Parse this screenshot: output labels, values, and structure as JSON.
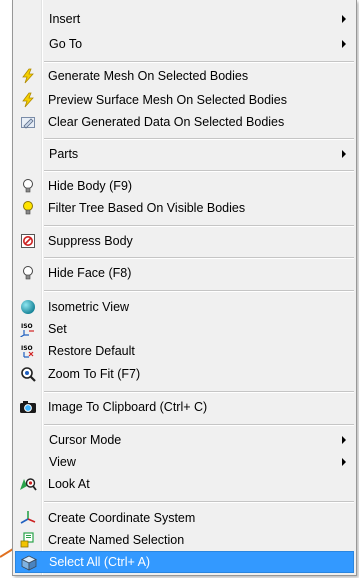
{
  "menu": {
    "items": [
      {
        "id": "insert",
        "label": "Insert",
        "submenu": true,
        "icon": ""
      },
      {
        "id": "goto",
        "label": "Go To",
        "submenu": true,
        "icon": ""
      },
      {
        "id": "generate-mesh",
        "label": "Generate Mesh On Selected Bodies",
        "icon": "lightning-bolt-icon"
      },
      {
        "id": "preview-surface-mesh",
        "label": "Preview Surface Mesh On Selected Bodies",
        "icon": "lightning-bolt-icon"
      },
      {
        "id": "clear-generated-data",
        "label": "Clear Generated Data On Selected Bodies",
        "icon": "eraser-icon"
      },
      {
        "id": "parts",
        "label": "Parts",
        "submenu": true,
        "icon": ""
      },
      {
        "id": "hide-body",
        "label": "Hide Body (F9)",
        "icon": "lightbulb-off-icon"
      },
      {
        "id": "filter-tree",
        "label": "Filter Tree Based On Visible Bodies",
        "icon": "lightbulb-on-icon"
      },
      {
        "id": "suppress-body",
        "label": "Suppress Body",
        "icon": "suppress-icon"
      },
      {
        "id": "hide-face",
        "label": "Hide Face (F8)",
        "icon": "lightbulb-off-icon"
      },
      {
        "id": "isometric-view",
        "label": "Isometric View",
        "icon": "sphere-icon"
      },
      {
        "id": "set",
        "label": "Set",
        "icon": "iso-set-icon"
      },
      {
        "id": "restore-default",
        "label": "Restore Default",
        "icon": "iso-restore-icon"
      },
      {
        "id": "zoom-to-fit",
        "label": "Zoom To Fit (F7)",
        "icon": "magnifier-icon"
      },
      {
        "id": "image-to-clipboard",
        "label": "Image To Clipboard (Ctrl+ C)",
        "icon": "camera-icon"
      },
      {
        "id": "cursor-mode",
        "label": "Cursor Mode",
        "submenu": true,
        "icon": ""
      },
      {
        "id": "view",
        "label": "View",
        "submenu": true,
        "icon": ""
      },
      {
        "id": "look-at",
        "label": "Look At",
        "icon": "look-at-icon"
      },
      {
        "id": "create-coordinate-system",
        "label": "Create Coordinate System",
        "icon": "axes-icon"
      },
      {
        "id": "create-named-selection",
        "label": "Create Named Selection",
        "icon": "named-selection-icon"
      },
      {
        "id": "select-all",
        "label": "Select All (Ctrl+ A)",
        "icon": "cube-select-icon",
        "selected": true
      }
    ]
  },
  "colors": {
    "highlight": "#3399ff",
    "menu_bg": "#f0f0f0",
    "bolt": "#f5d000",
    "sphere": "#1ca3b8"
  }
}
